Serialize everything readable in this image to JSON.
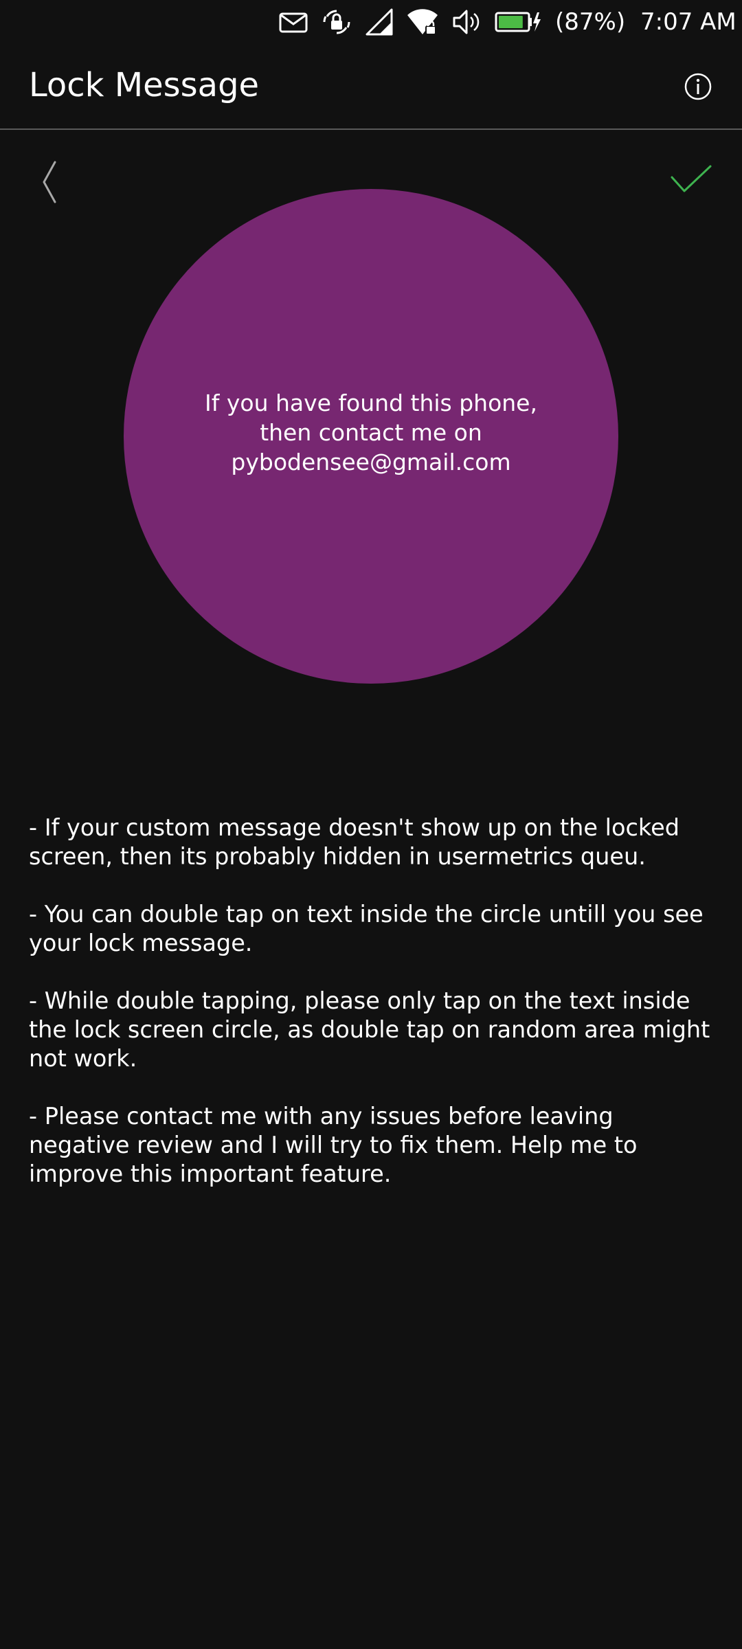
{
  "status_bar": {
    "battery_percent": "(87%)",
    "time": "7:07 AM",
    "battery_level": 0.87,
    "battery_color": "#4cbb45",
    "icons": [
      "mail-icon",
      "rotation-lock-icon",
      "signal-icon",
      "wifi-icon",
      "volume-icon",
      "battery-charging-icon"
    ]
  },
  "header": {
    "title": "Lock Message",
    "info_icon": "info-icon"
  },
  "toolbar": {
    "back_icon": "chevron-left-icon",
    "confirm_icon": "checkmark-icon",
    "confirm_color": "#3eb34f"
  },
  "preview": {
    "circle_color": "#772771",
    "lines": [
      "If you have found this phone,",
      "then contact me on",
      "pybodensee@gmail.com"
    ]
  },
  "notes": [
    "- If your custom message doesn't show up on the locked screen, then its probably hidden in usermetrics queu.",
    "- You can double tap on text inside the circle untill you see your lock message.",
    "- While double tapping, please only tap on the text inside the lock screen circle, as double tap on random area might not work.",
    "- Please contact me with any issues before leaving negative review and I will try to fix them. Help me to improve this important feature."
  ]
}
